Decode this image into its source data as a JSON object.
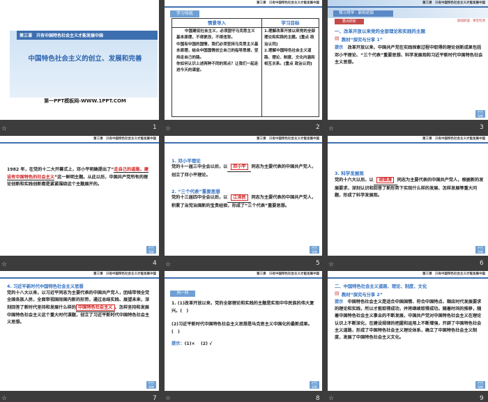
{
  "header_text": "第三课　只有中国特色社会主义才能发展中国",
  "slide_numbers": [
    "1",
    "2",
    "3",
    "4",
    "5",
    "6",
    "7",
    "8",
    "9"
  ],
  "back_label": "栏目\n导航",
  "s1": {
    "banner": "第三课　只有中国特色社会主义才能发展中国",
    "title": "中国特色社会主义的创立、发展和完善",
    "footer": "第一PPT模板网-WWW.1PPT.COM"
  },
  "s2": {
    "badge": "学习导航",
    "col_left": "情景导入",
    "col_right": "学习目标",
    "left_text": "中国建设社会主义，必须固守马克思主义基本原理，不得更改，不得违背。\n中国有中国的国情，我们必须坚持马克思主义基本原理，结合中国国情创立自己的指导思想，坚持走自己的路。\n你如何认识上述两种不同的观点？让我们一起走进今天的课堂。",
    "right_text": "1.理解改革开放以来党的全部理论和实践的主题。[重点 政治认同]\n2.理解中国特色社会主义道路、理论、制度、文化内涵和相互关系。[重点 政治认同]"
  },
  "s3": {
    "badge_a": "预习导学",
    "badge_b": "新知初探",
    "small_tag": "要点研析",
    "right_tag": "基础梳理 · 课堂检测",
    "head1": "一、改革开放以来党的全部理论和实践的主题",
    "head2": "教材“探究与分享 1”",
    "answer_label": "提示",
    "answer": "改革开放以来，中国共产党在实践探索过程中取得的理论创新成果包括邓小平理论、“三个代表”重要思想、科学发展观和习近平新时代中国特色社会主义思想。"
  },
  "s4": {
    "p1": "1982 年，在党的十二大开幕式上，邓小平明确提出了“",
    "red": "走自己的道路，建设有中国特色的社会主义",
    "p2": "”这一鲜明主题。从此以后，中国共产党所有的理论创新和实践创新都是紧紧围绕这个主题展开的。"
  },
  "s5": {
    "h1": "1. 邓小平理论",
    "t1a": "党的十一届三中全会以后，以",
    "t1_fill": "邓小平",
    "t1b": "同志为主要代表的中国共产党人，创立了邓小平理论。",
    "h2": "2. “三个代表”重要思想",
    "t2a": "党的十三届四中全会以后，以",
    "t2_fill": "江泽民",
    "t2b": "同志为主要代表的中国共产党人，积累了治党治国新的宝贵经验，形成了“三个代表”重要思想。"
  },
  "s6": {
    "h": "3. 科学发展观",
    "ta": "党的十六大以后，以",
    "fill": "胡锦涛",
    "tb": "同志为主要代表的中国共产党人，根据新的发展要求，深刻认识和回答了新形势下实现什么样的发展、怎样发展等重大问题，形成了科学发展观。"
  },
  "s7": {
    "h": "4. 习近平新时代中国特色社会主义思想",
    "ta": "党的十八大以来，以习近平同志为主要代表的中国共产党人，团结带领全党全国各族人民，全面审视国际国内新的形势，通过总结实践、展望未来，深刻回答了新时代坚持和发展什么样的",
    "fill": "中国特色社会主义",
    "tb": "、怎样坚持和发展中国特色社会主义这个重大时代课题，创立了习近平新时代中国特色社会主义思想。"
  },
  "s8": {
    "badge": "判一判",
    "q1": "1. (1)改革开放以来，党的全部理论和实践的主题是实现中华民族的伟大复兴。(　)",
    "q2": "(2)习近平新时代中国特色社会主义思想是马克思主义中国化的最新成果。(　)",
    "hint_label": "提示：",
    "hint": "(1)× 　(2) √"
  },
  "s9": {
    "head1": "二、中国特色社会主义道路、理论、制度、文化",
    "head2": "教材“探究与分享 2”",
    "answer_label": "提示",
    "answer": "中国特色社会主义是适合中国国情、符合中国特点、顺应时代发展要求的理论和实践，所以才能取得成功，并将继续取得成功。随着时间的推移，随着中国特色社会主义事业的不断发展，中国共产党对中国特色社会主义在理论认识上不断深化，在建设规律的把握和运用上不断增强，开辟了中国特色社会主义道路，形成了中国特色社会主义理论体系，确立了中国特色社会主义制度，发展了中国特色社会主义文化。"
  }
}
